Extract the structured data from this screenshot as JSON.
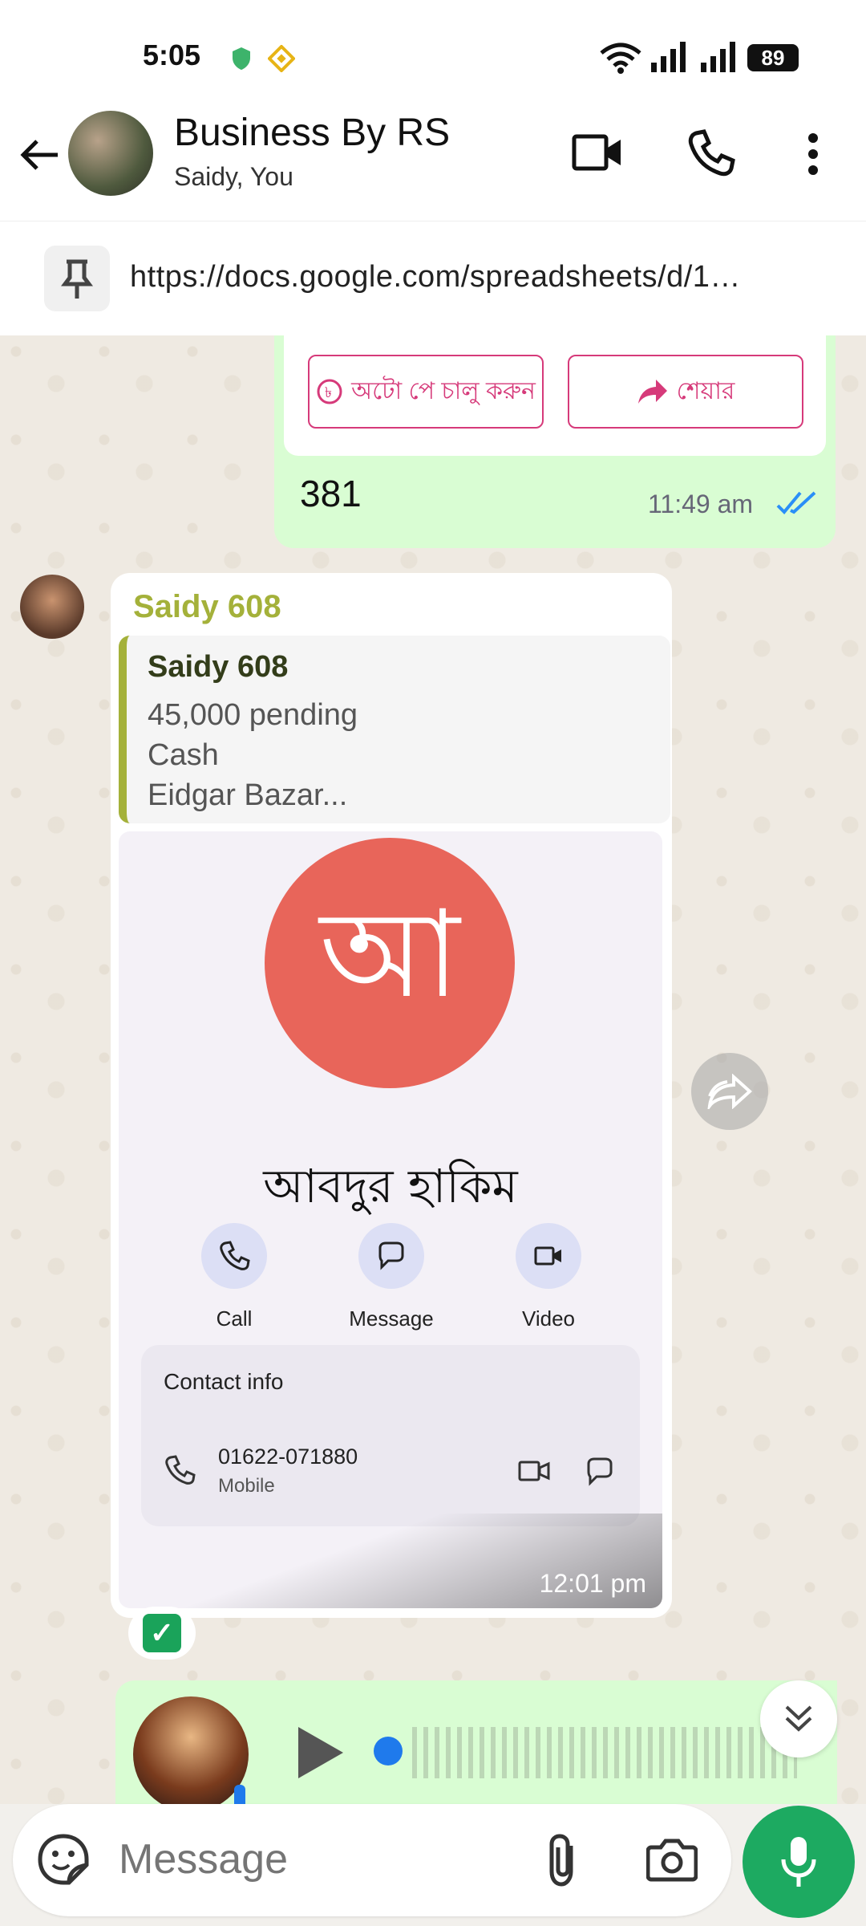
{
  "status_bar": {
    "time": "5:05",
    "battery": "89"
  },
  "header": {
    "title": "Business By RS",
    "subtitle": "Saidy, You"
  },
  "pinned": {
    "text": "https://docs.google.com/spreadsheets/d/1…"
  },
  "outgoing": {
    "button_autopay": "অটো পে চালু করুন",
    "button_share": "শেয়ার",
    "text": "381",
    "time": "11:49 am"
  },
  "incoming": {
    "sender": "Saidy 608",
    "quote": {
      "name": "Saidy 608",
      "line1": "45,000 pending",
      "line2": "Cash",
      "line3": "Eidgar Bazar..."
    },
    "contact": {
      "initial": "আ",
      "name": "আবদুর হাকিম",
      "actions": {
        "call": "Call",
        "message": "Message",
        "video": "Video"
      },
      "info_title": "Contact info",
      "phone": "01622-071880",
      "phone_type": "Mobile"
    },
    "time": "12:01 pm"
  },
  "input": {
    "placeholder": "Message"
  }
}
